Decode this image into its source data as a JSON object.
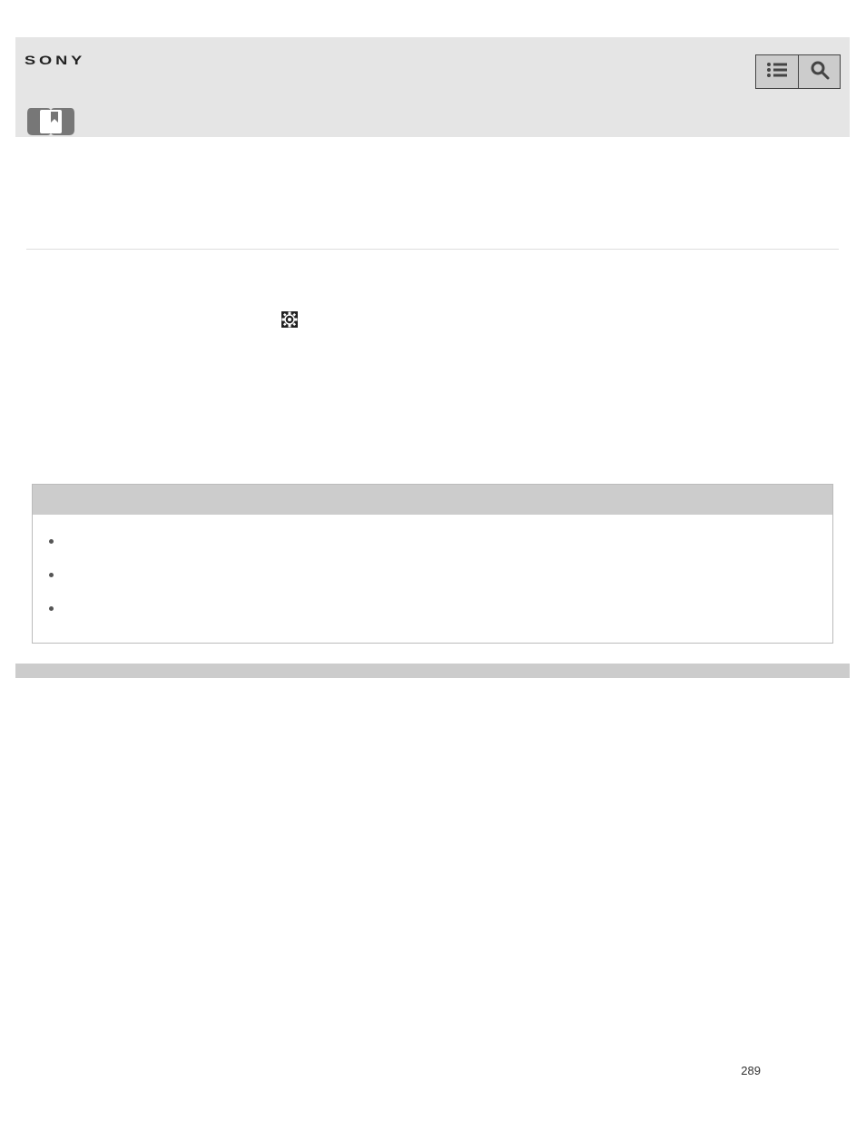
{
  "logo_text": "SONY",
  "page_number": "289",
  "note_items": [
    "",
    "",
    ""
  ]
}
